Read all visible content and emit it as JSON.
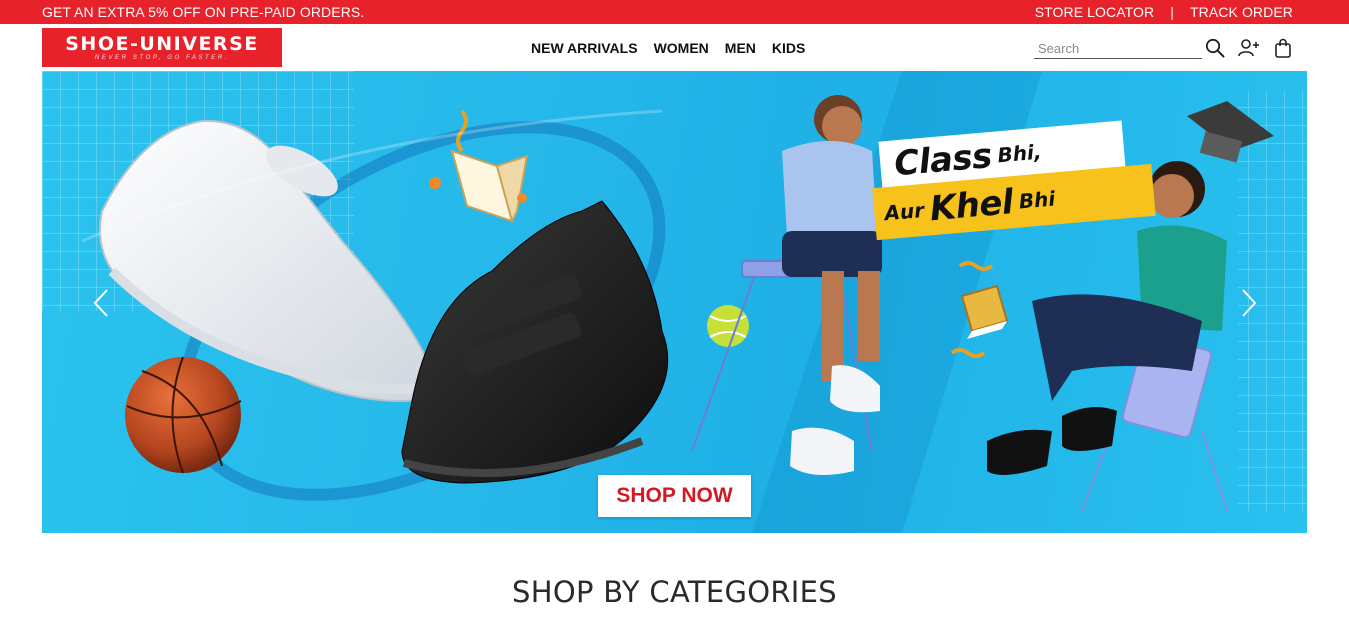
{
  "promo": {
    "message": "GET AN EXTRA 5% OFF ON PRE-PAID ORDERS.",
    "store_locator": "STORE LOCATOR",
    "separator": "|",
    "track_order": "TRACK ORDER"
  },
  "brand": {
    "name": "SHOE-UNIVERSE",
    "tagline": "NEVER STOP, GO FASTER.",
    "color": "#e8222b"
  },
  "nav": {
    "items": [
      {
        "label": "NEW ARRIVALS"
      },
      {
        "label": "WOMEN"
      },
      {
        "label": "MEN"
      },
      {
        "label": "KIDS"
      }
    ]
  },
  "search": {
    "placeholder": "Search",
    "value": ""
  },
  "header_icons": [
    "search-icon",
    "add-user-icon",
    "shopping-bag-icon"
  ],
  "hero": {
    "headline_part1": "Class",
    "headline_part2": "Bhi,",
    "headline_part3": "Aur",
    "headline_part4": "Khel",
    "headline_part5": "Bhi",
    "cta": "SHOP NOW",
    "background_color": "#25b7e9",
    "highlight_color": "#f6c21b"
  },
  "section": {
    "title": "SHOP BY CATEGORIES"
  }
}
